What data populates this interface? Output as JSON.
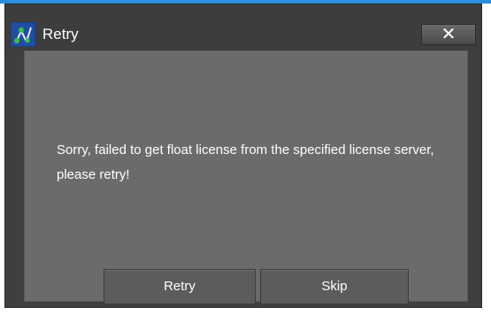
{
  "window": {
    "title": "Retry",
    "close_label": "✕"
  },
  "dialog": {
    "message": "Sorry, failed to get float license from the specified license server, please retry!",
    "retry_label": "Retry",
    "skip_label": "Skip"
  },
  "colors": {
    "accent": "#2b8ce0",
    "window_bg": "#3f3f3f",
    "client_bg": "#6b6b6b",
    "button_bg": "#5c5c5c",
    "text": "#ffffff"
  },
  "icons": {
    "app": "app-logo-icon",
    "close": "close-icon"
  }
}
